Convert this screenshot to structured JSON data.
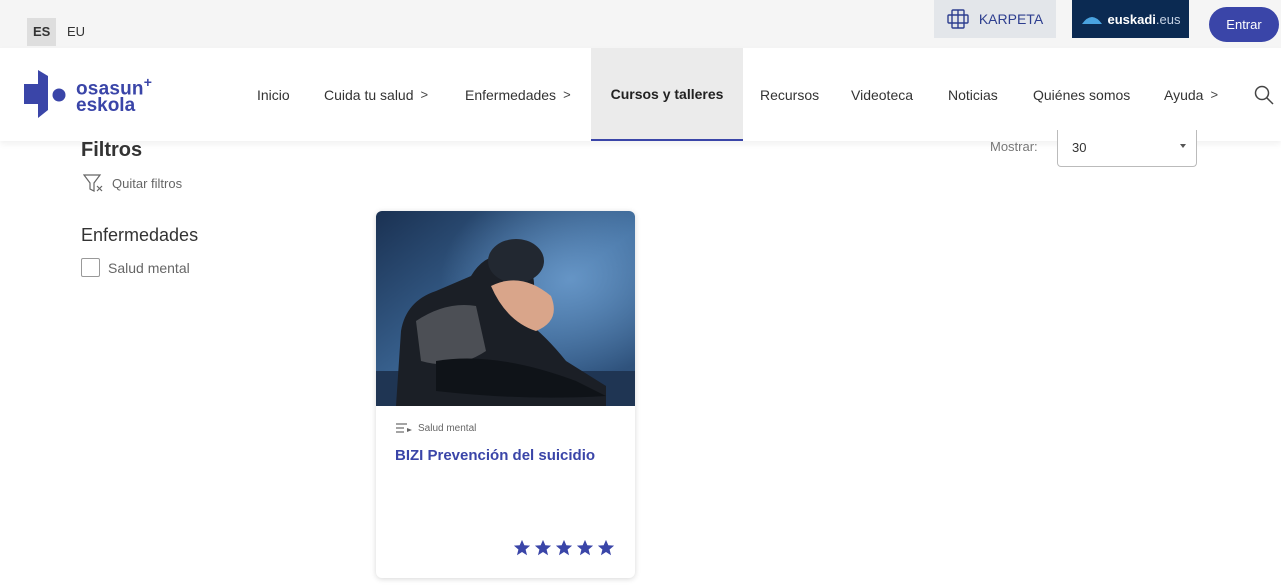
{
  "topbar": {
    "lang_es": "ES",
    "lang_eu": "EU",
    "karpeta_label": "KARPETA",
    "euskadi_brand": "euskadi",
    "euskadi_suffix": ".eus",
    "login_label": "Entrar"
  },
  "logo": {
    "line1": "osasun",
    "plus": "+",
    "line2": "eskola"
  },
  "nav": {
    "items": [
      {
        "label": "Inicio"
      },
      {
        "label": "Cuida tu salud",
        "chevron": ">"
      },
      {
        "label": "Enfermedades",
        "chevron": ">"
      },
      {
        "label": "Cursos y talleres",
        "active": true
      },
      {
        "label": "Recursos"
      },
      {
        "label": "Videoteca"
      },
      {
        "label": "Noticias"
      },
      {
        "label": "Quiénes somos"
      },
      {
        "label": "Ayuda",
        "chevron": ">"
      }
    ]
  },
  "filters": {
    "title": "Filtros",
    "clear_label": "Quitar filtros",
    "group_title": "Enfermedades",
    "options": [
      {
        "label": "Salud mental",
        "checked": false
      }
    ]
  },
  "display": {
    "label": "Mostrar:",
    "value": "30"
  },
  "courses": [
    {
      "category": "Salud mental",
      "title": "BIZI Prevención del suicidio",
      "rating": 5,
      "rating_max": 5
    }
  ],
  "colors": {
    "accent": "#3a45a8",
    "euskadi_bg": "#0b2a52",
    "topbar_bg": "#f5f5f5"
  },
  "icons": {
    "karpeta": "karpeta-icon",
    "search": "search-icon",
    "filter_clear": "filter-clear-icon",
    "category": "playlist-icon",
    "star": "star-icon"
  }
}
